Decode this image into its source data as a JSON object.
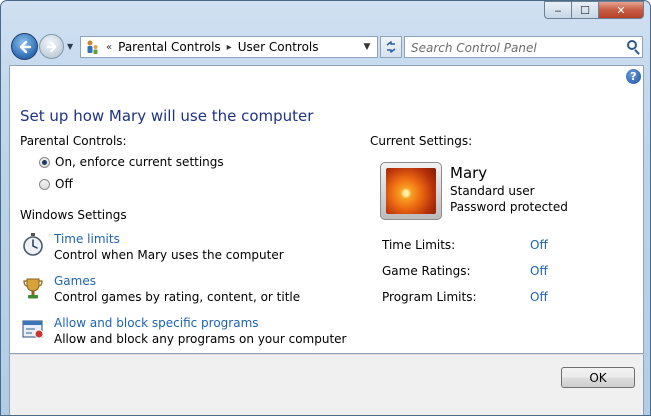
{
  "window": {
    "caption": {
      "minimize": "‒",
      "maximize": "☐",
      "close": "✕"
    }
  },
  "navbar": {
    "breadcrumb_prefix": "«",
    "breadcrumb": [
      "Parental Controls",
      "User Controls"
    ],
    "breadcrumb_separator": "▸",
    "search_placeholder": "Search Control Panel"
  },
  "content": {
    "help_label": "?",
    "title": "Set up how Mary will use the computer",
    "parental_controls_label": "Parental Controls:",
    "radio_on": "On, enforce current settings",
    "radio_off": "Off",
    "radio_selected": "on",
    "windows_settings_label": "Windows Settings",
    "tasks": [
      {
        "icon": "stopwatch-icon",
        "link": "Time limits",
        "desc": "Control when Mary uses the computer"
      },
      {
        "icon": "trophy-icon",
        "link": "Games",
        "desc": "Control games by rating, content, or title"
      },
      {
        "icon": "program-window-icon",
        "link": "Allow and block specific programs",
        "desc": "Allow and block any programs on your computer"
      }
    ],
    "current_settings_label": "Current Settings:",
    "user": {
      "name": "Mary",
      "type": "Standard user",
      "password": "Password protected"
    },
    "settings": [
      {
        "label": "Time Limits:",
        "value": "Off"
      },
      {
        "label": "Game Ratings:",
        "value": "Off"
      },
      {
        "label": "Program Limits:",
        "value": "Off"
      }
    ]
  },
  "footer": {
    "ok_label": "OK"
  }
}
